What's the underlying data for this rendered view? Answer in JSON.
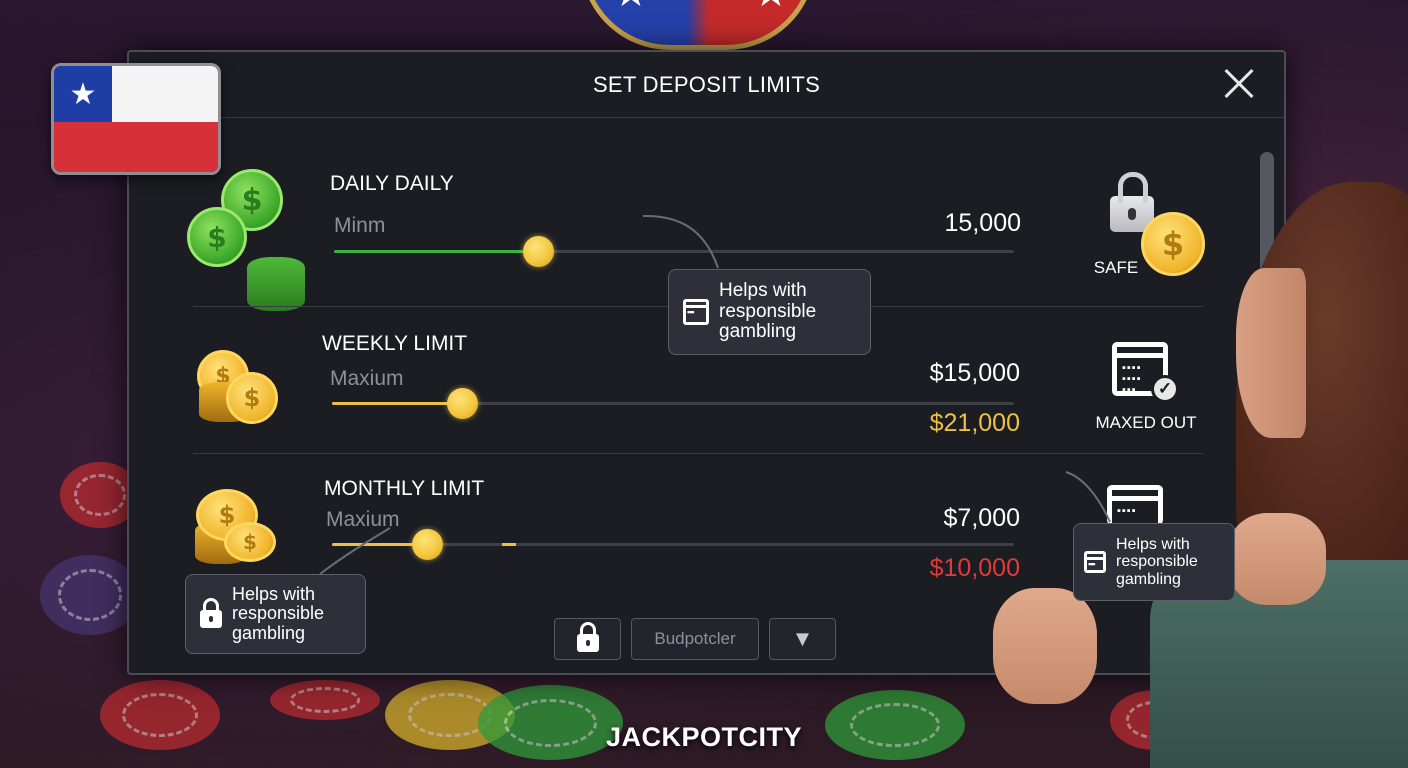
{
  "modal": {
    "title": "SET DEPOSIT LIMITS",
    "close_icon": "close-icon"
  },
  "rows": [
    {
      "title": "DAILY DAILY",
      "sub_label": "Minm",
      "amount": "15,000",
      "fill_fraction": 0.3,
      "fill_color": "#3cb043",
      "coin_color": "green",
      "side_icon": "lock-coin-icon",
      "side_label": "SAFE"
    },
    {
      "title": "WEEKLY LIMIT",
      "sub_label": "Maxium",
      "amount": "$15,000",
      "secondary_amount": "$21,000",
      "secondary_color": "#f0c040",
      "fill_fraction": 0.19,
      "fill_color": "#f0c040",
      "coin_color": "gold",
      "side_icon": "calendar-check-icon",
      "side_label": "MAXED OUT"
    },
    {
      "title": "MONTHLY LIMIT",
      "sub_label": "Maxium",
      "amount": "$7,000",
      "secondary_amount": "$10,000",
      "secondary_color": "#e03a3a",
      "fill_fraction": 0.14,
      "fill_color": "#f0c040",
      "coin_color": "gold",
      "side_icon": "calendar-icon"
    }
  ],
  "tooltips": {
    "top": "Helps with responsible gambling",
    "bottom_left": "Helps with responsible gambling",
    "right": "Helps with responsible gambling"
  },
  "controls": {
    "lock_icon": "lock-icon",
    "middle_label": "Budpotcler",
    "dropdown_icon": "chevron-down-icon"
  },
  "brand": "JACKPOTCITY",
  "flag": "chile-flag",
  "colors": {
    "modal_bg": "#1b1d23",
    "accent_gold": "#f0c040",
    "accent_green": "#3cb043",
    "warn_red": "#e03a3a"
  }
}
